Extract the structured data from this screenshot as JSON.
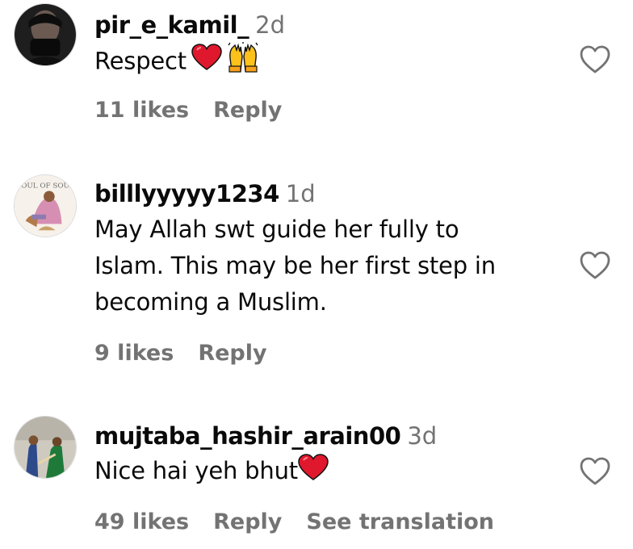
{
  "comments": [
    {
      "username": "pir_e_kamil_",
      "time": "2d",
      "text": "Respect",
      "emojis": [
        "heart-emoji",
        "raising-hands-emoji"
      ],
      "likes": "11 likes",
      "reply": "Reply"
    },
    {
      "username": "billlyyyyy1234",
      "time": "1d",
      "text_lines": [
        "May Allah swt guide her fully to",
        "Islam. This may be her first step in",
        "becoming a Muslim."
      ],
      "likes": "9 likes",
      "reply": "Reply",
      "avatar_text": "SOUL OF SOUL"
    },
    {
      "username": "mujtaba_hashir_arain00",
      "time": "3d",
      "text": "Nice hai yeh bhut",
      "emojis": [
        "heart-emoji"
      ],
      "likes": "49 likes",
      "reply": "Reply",
      "translation": "See translation"
    }
  ],
  "colors": {
    "text": "#0a0a0a",
    "secondary": "#737373",
    "heart_emoji": "#e0182d"
  }
}
